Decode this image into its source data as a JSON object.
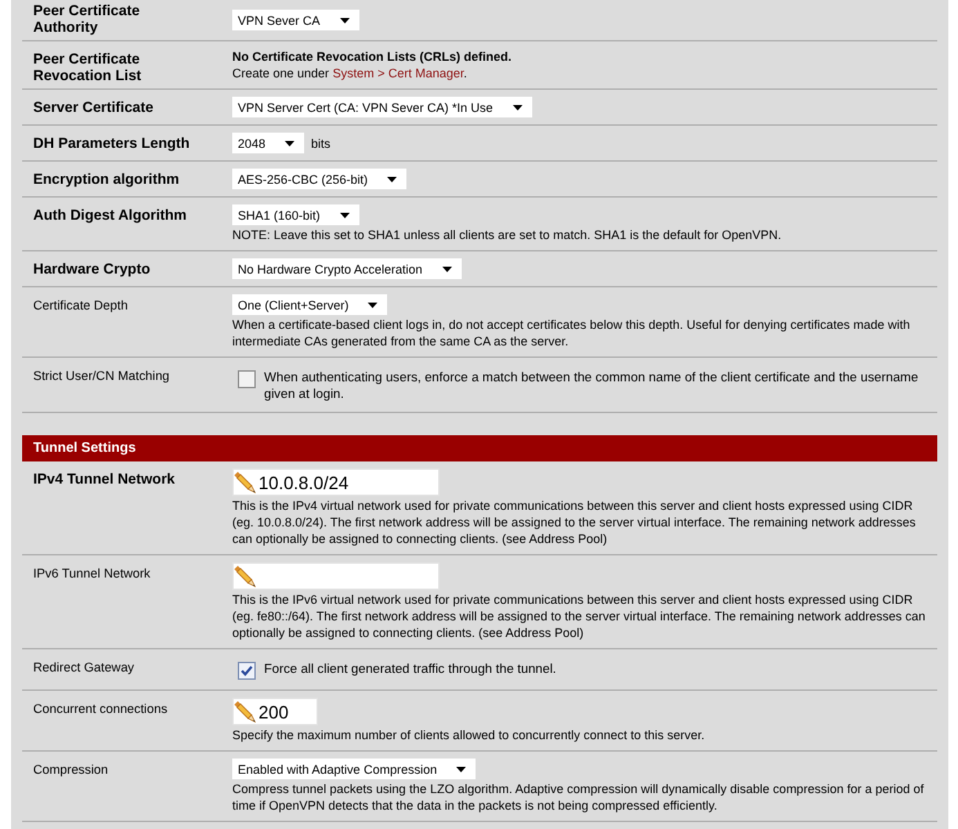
{
  "sections": [
    {
      "rows": [
        {
          "label": "Peer Certificate Authority",
          "required": true,
          "kind": "select",
          "value": "VPN Sever CA"
        },
        {
          "label": "Peer Certificate Revocation List",
          "required": true,
          "kind": "info",
          "message": "No Certificate Revocation Lists (CRLs) defined.",
          "hint": {
            "before": "Create one under",
            "link": "System > Cert Manager",
            "after": "."
          }
        },
        {
          "label": "Server Certificate",
          "required": true,
          "kind": "select",
          "value": "VPN Server Cert (CA: VPN Sever CA) *In Use"
        },
        {
          "label": "DH Parameters Length",
          "required": true,
          "kind": "select",
          "value": "2048",
          "unit": "bits"
        },
        {
          "label": "Encryption algorithm",
          "required": true,
          "kind": "select",
          "value": "AES-256-CBC (256-bit)"
        },
        {
          "label": "Auth Digest Algorithm",
          "required": true,
          "kind": "select",
          "value": "SHA1 (160-bit)",
          "description": "NOTE: Leave this set to SHA1 unless all clients are set to match. SHA1 is the default for OpenVPN."
        },
        {
          "label": "Hardware Crypto",
          "required": true,
          "kind": "select",
          "value": "No Hardware Crypto Acceleration"
        },
        {
          "label": "Certificate Depth",
          "required": false,
          "kind": "select",
          "value": "One (Client+Server)",
          "description": "When a certificate-based client logs in, do not accept certificates below this depth. Useful for denying certificates made with intermediate CAs generated from the same CA as the server."
        },
        {
          "label": "Strict User/CN Matching",
          "required": false,
          "kind": "checkbox",
          "checked": false,
          "caption": "When authenticating users, enforce a match between the common name of the client certificate and the username given at login."
        }
      ]
    },
    {
      "title": "Tunnel Settings",
      "rows": [
        {
          "label": "IPv4 Tunnel Network",
          "required": true,
          "kind": "text",
          "value": "10.0.8.0/24",
          "description": "This is the IPv4 virtual network used for private communications between this server and client hosts expressed using CIDR (eg. 10.0.8.0/24). The first network address will be assigned to the server virtual interface. The remaining network addresses can optionally be assigned to connecting clients. (see Address Pool)"
        },
        {
          "label": "IPv6 Tunnel Network",
          "required": false,
          "kind": "text",
          "description": "This is the IPv6 virtual network used for private communications between this server and client hosts expressed using CIDR (eg. fe80::/64). The first network address will be assigned to the server virtual interface. The remaining network addresses can optionally be assigned to connecting clients. (see Address Pool)"
        },
        {
          "label": "Redirect Gateway",
          "required": false,
          "kind": "checkbox",
          "checked": true,
          "caption": "Force all client generated traffic through the tunnel."
        },
        {
          "label": "Concurrent connections",
          "required": false,
          "kind": "number",
          "value": "200",
          "description": "Specify the maximum number of clients allowed to concurrently connect to this server."
        },
        {
          "label": "Compression",
          "required": false,
          "kind": "select",
          "value": "Enabled with Adaptive Compression",
          "description": "Compress tunnel packets using the LZO algorithm. Adaptive compression will dynamically disable compression for a period of time if OpenVPN detects that the data in the packets is not being compressed efficiently."
        }
      ]
    }
  ]
}
